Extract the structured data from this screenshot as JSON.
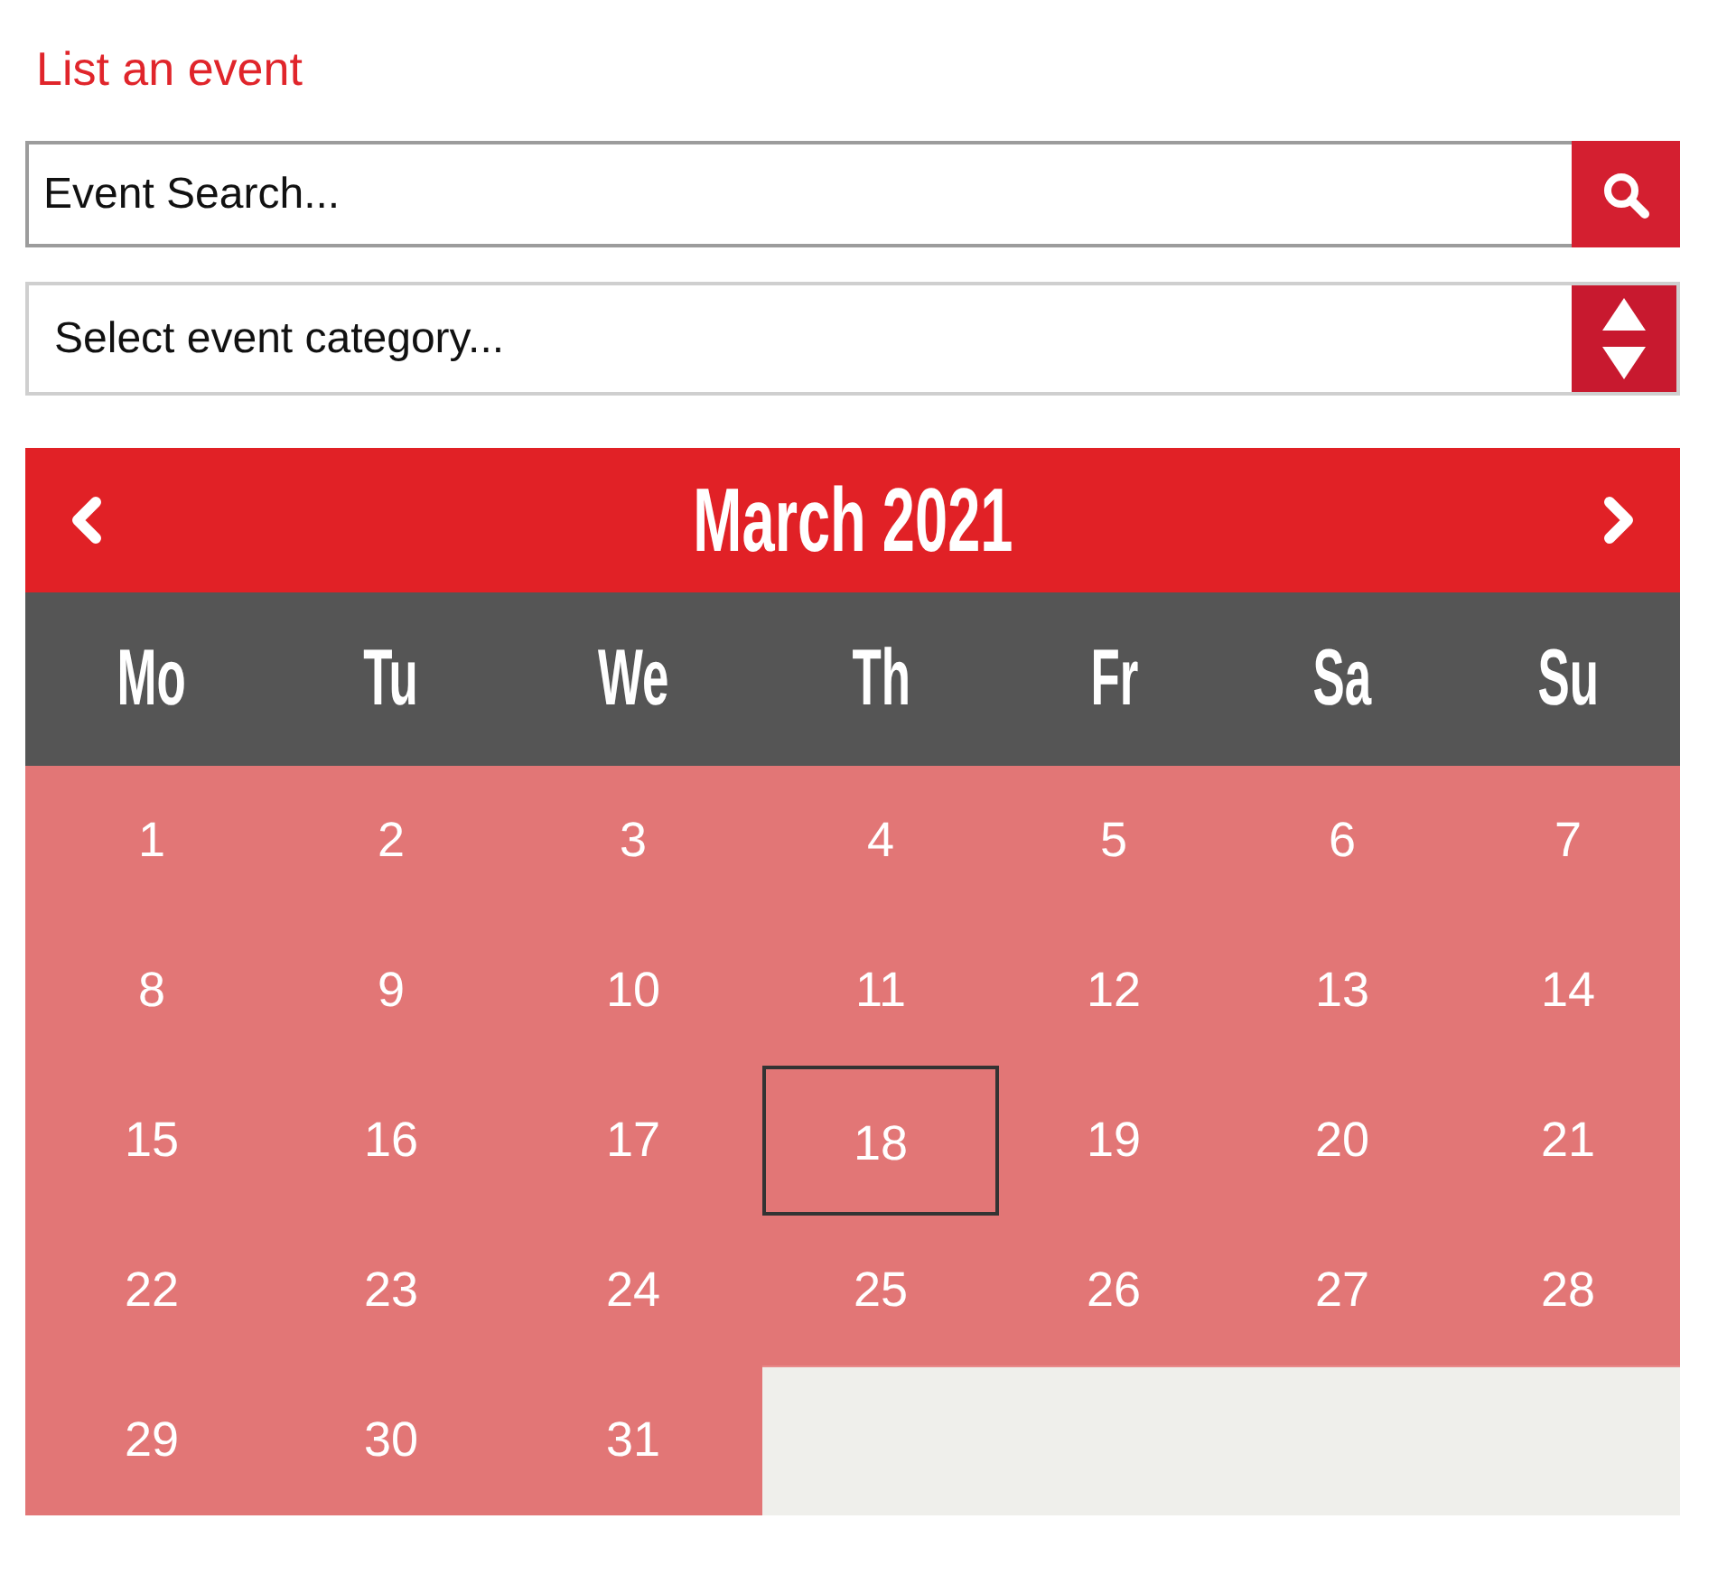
{
  "link": {
    "label": "List an event"
  },
  "search": {
    "placeholder": "Event Search..."
  },
  "category_select": {
    "value": "Select event category..."
  },
  "calendar": {
    "title": "March 2021",
    "weekdays": [
      "Mo",
      "Tu",
      "We",
      "Th",
      "Fr",
      "Sa",
      "Su"
    ],
    "weeks": [
      [
        {
          "day": "1",
          "today": false
        },
        {
          "day": "2",
          "today": false
        },
        {
          "day": "3",
          "today": false
        },
        {
          "day": "4",
          "today": false
        },
        {
          "day": "5",
          "today": false
        },
        {
          "day": "6",
          "today": false
        },
        {
          "day": "7",
          "today": false
        }
      ],
      [
        {
          "day": "8",
          "today": false
        },
        {
          "day": "9",
          "today": false
        },
        {
          "day": "10",
          "today": false
        },
        {
          "day": "11",
          "today": false
        },
        {
          "day": "12",
          "today": false
        },
        {
          "day": "13",
          "today": false
        },
        {
          "day": "14",
          "today": false
        }
      ],
      [
        {
          "day": "15",
          "today": false
        },
        {
          "day": "16",
          "today": false
        },
        {
          "day": "17",
          "today": false
        },
        {
          "day": "18",
          "today": true
        },
        {
          "day": "19",
          "today": false
        },
        {
          "day": "20",
          "today": false
        },
        {
          "day": "21",
          "today": false
        }
      ],
      [
        {
          "day": "22",
          "today": false
        },
        {
          "day": "23",
          "today": false
        },
        {
          "day": "24",
          "today": false
        },
        {
          "day": "25",
          "today": false
        },
        {
          "day": "26",
          "today": false
        },
        {
          "day": "27",
          "today": false
        },
        {
          "day": "28",
          "today": false
        }
      ],
      [
        {
          "day": "29",
          "today": false
        },
        {
          "day": "30",
          "today": false
        },
        {
          "day": "31",
          "today": false
        }
      ]
    ]
  }
}
